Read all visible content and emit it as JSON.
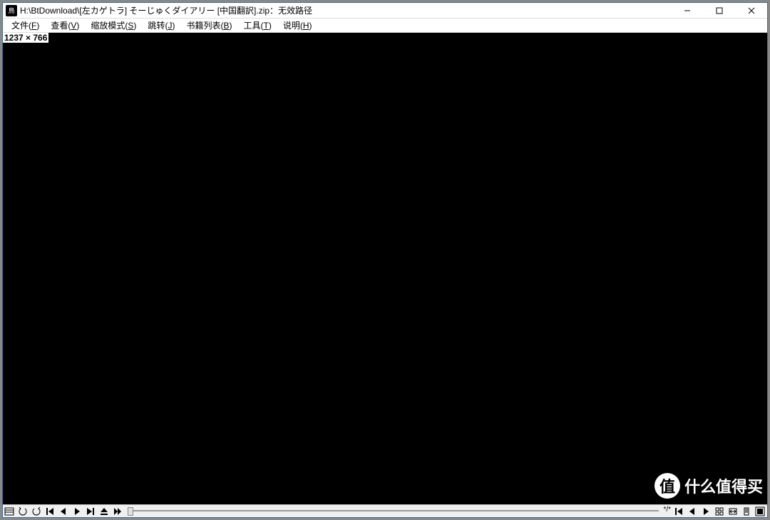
{
  "title": "H:\\BtDownload\\[左カゲトラ] そーじゅくダイアリー [中国翻訳].zip：无效路径",
  "menu": {
    "file": {
      "label": "文件",
      "key": "F"
    },
    "view": {
      "label": "查看",
      "key": "V"
    },
    "scale": {
      "label": "缩放模式",
      "key": "S"
    },
    "jump": {
      "label": "跳转",
      "key": "J"
    },
    "books": {
      "label": "书籍列表",
      "key": "B"
    },
    "tools": {
      "label": "工具",
      "key": "T"
    },
    "help": {
      "label": "说明",
      "key": "H"
    }
  },
  "dimensions": "1237 × 766",
  "status": {
    "leftlabel": "*/*"
  },
  "watermark": "什么值得买",
  "watermark_badge": "值"
}
